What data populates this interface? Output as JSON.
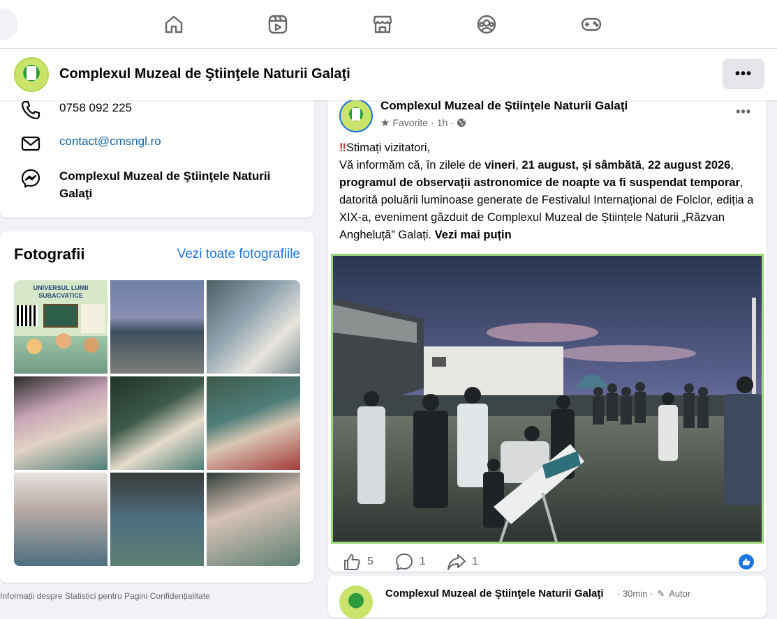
{
  "nav": {
    "icons": [
      "home-icon",
      "video-icon",
      "marketplace-icon",
      "groups-icon",
      "gaming-icon"
    ]
  },
  "page": {
    "name": "Complexul Muzeal de Ştiinţele Naturii Galaţi",
    "more_label": "•••"
  },
  "contact": {
    "phone": "0758 092 225",
    "email": "contact@cmsngl.ro",
    "messenger": "Complexul Muzeal de Ştiinţele Naturii Galaţi"
  },
  "photos": {
    "title": "Fotografii",
    "see_all": "Vezi toate fotografiile",
    "tile_colors": [
      "#d7e7c9",
      "#6f7fa6",
      "#8fa3b0",
      "#c7a4b6",
      "#3d5a4b",
      "#4f7e78",
      "#b8a9a4",
      "#4c6f80",
      "#5e7f73"
    ],
    "poster_text": "UNIVERSUL LUMII SUBACVATICE"
  },
  "footer": {
    "text": "Informații despre  Statistici pentru  Pagini  Confidențialitate"
  },
  "post": {
    "author": "Complexul Muzeal de Ştiinţele Naturii Galaţi",
    "meta_label": "Favorite",
    "meta_time": "1h",
    "more_label": "•••",
    "line1": "Stimați vizitatori,",
    "p_intro": "Vă informăm că, în zilele de ",
    "p_vineri": "vineri",
    "p_comma1": ", ",
    "p_date1": "21 august",
    "p_comma2": ", și sâmbătă",
    "p_comma3": ", ",
    "p_date2": "22 august 2026",
    "p_comma4": ", ",
    "p_bold": "programul de observații astronomice de noapte va fi suspendat temporar",
    "p_rest": ", datorită poluării luminoase generate de Festivalul Internațional de Folclor, ediția a XIX-a, eveniment găzduit de Complexul Muzeal de Științele Naturii „Răzvan Angheluță” Galați. ",
    "see_less": "Vezi mai puțin",
    "likes": "5",
    "comments": "1",
    "shares": "1"
  },
  "post2": {
    "author": "Complexul Muzeal de Ştiinţele Naturii Galaţi",
    "time": "· 30min ·",
    "badge": "Autor"
  }
}
